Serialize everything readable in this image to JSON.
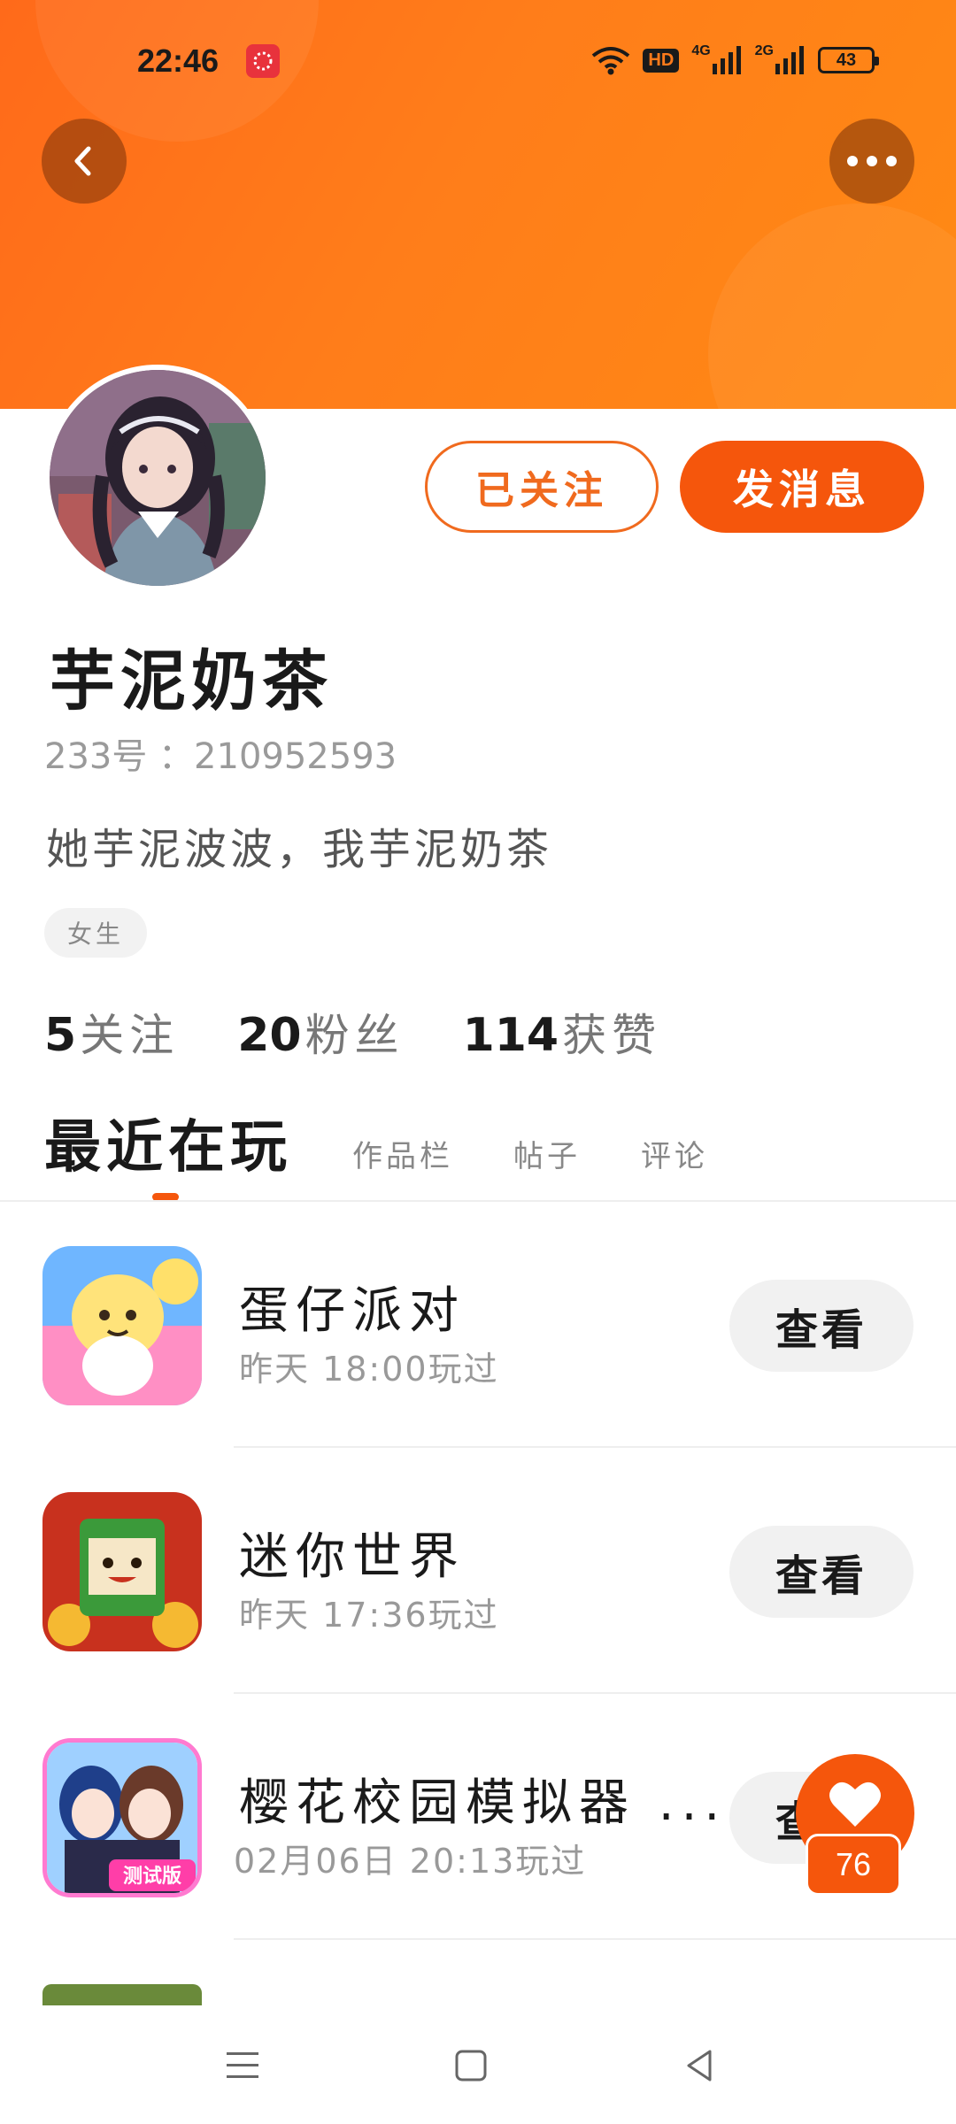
{
  "status_bar": {
    "time": "22:46",
    "hd_badge": "HD",
    "signal1_label": "4G",
    "signal2_label": "2G",
    "battery": "43"
  },
  "header": {
    "back_icon": "chevron-left-icon",
    "more_icon": "more-horizontal-icon"
  },
  "profile": {
    "nickname": "芋泥奶茶",
    "user_id": "233号 ：210952593",
    "bio": "她芋泥波波，我芋泥奶茶",
    "tag": "女生",
    "followed_label": "已关注",
    "message_label": "发消息"
  },
  "stats": [
    {
      "num": "5",
      "label": "关注"
    },
    {
      "num": "20",
      "label": "粉丝"
    },
    {
      "num": "114",
      "label": "获赞"
    }
  ],
  "tabs": {
    "active": "最近在玩",
    "items": [
      "作品栏",
      "帖子",
      "评论"
    ]
  },
  "games": [
    {
      "title": "蛋仔派对",
      "time": "昨天 18:00玩过",
      "button": "查看"
    },
    {
      "title": "迷你世界",
      "time": "昨天 17:36玩过",
      "button": "查看"
    },
    {
      "title": "樱花校园模拟器 ...",
      "time": "02月06日 20:13玩过",
      "button": "查看",
      "icon_badge": "测试版"
    }
  ],
  "fab": {
    "like_count": "76"
  },
  "colors": {
    "accent": "#f5560c",
    "banner": "#ff7d1a"
  }
}
